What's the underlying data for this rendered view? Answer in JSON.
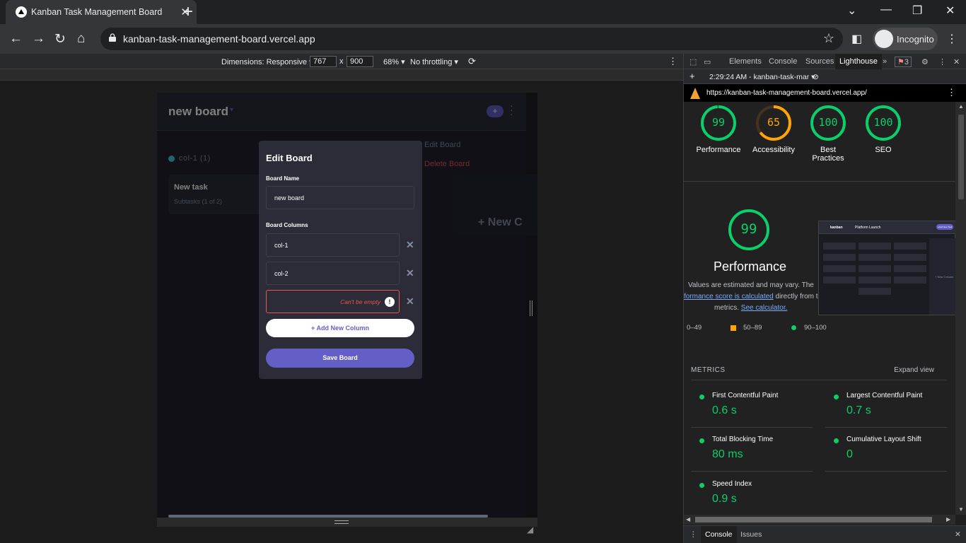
{
  "browser": {
    "tab_title": "Kanban Task Management Board",
    "url": "kanban-task-management-board.vercel.app",
    "incognito_label": "Incognito"
  },
  "device_toolbar": {
    "dimensions": "Dimensions: Responsive",
    "width": "767",
    "separator": "x",
    "height": "900",
    "zoom": "68%",
    "throttling": "No throttling"
  },
  "app": {
    "board_title": "new board",
    "add_icon": "+",
    "column_name": "col-1 (1)",
    "task_title": "New task",
    "task_subtasks": "Subtasks (1 of 2)",
    "new_column": "+ New C",
    "menu_edit": "Edit Board",
    "menu_delete": "Delete Board"
  },
  "modal": {
    "title": "Edit Board",
    "board_name_label": "Board Name",
    "board_name_value": "new board",
    "columns_label": "Board Columns",
    "columns": [
      "col-1",
      "col-2",
      ""
    ],
    "error_text": "Can't be empty",
    "add_column": "+ Add New Column",
    "save": "Save Board"
  },
  "devtools": {
    "tabs": [
      "Elements",
      "Console",
      "Sources",
      "Lighthouse"
    ],
    "more": "»",
    "issues_badge": "3",
    "report_time": "2:29:24 AM - kanban-task-mar",
    "report_url": "https://kanban-task-management-board.vercel.app/",
    "scores": [
      {
        "value": "99",
        "label": "Performance",
        "color": "#0cce6b"
      },
      {
        "value": "65",
        "label": "Accessibility",
        "color": "#ffa400"
      },
      {
        "value": "100",
        "label": "Best Practices",
        "color": "#0cce6b"
      },
      {
        "value": "100",
        "label": "SEO",
        "color": "#0cce6b"
      }
    ],
    "perf_score": "99",
    "perf_title": "Performance",
    "note_line1": "Values are estimated and may vary. The",
    "note_link1": "formance score is calculated",
    "note_line2_tail": "directly from thes",
    "note_line3": "metrics.",
    "note_link2": "See calculator.",
    "legend": [
      "0–49",
      "50–89",
      "90–100"
    ],
    "metrics_heading": "METRICS",
    "expand": "Expand view",
    "metrics": [
      {
        "name": "First Contentful Paint",
        "value": "0.6 s"
      },
      {
        "name": "Largest Contentful Paint",
        "value": "0.7 s"
      },
      {
        "name": "Total Blocking Time",
        "value": "80 ms"
      },
      {
        "name": "Cumulative Layout Shift",
        "value": "0"
      },
      {
        "name": "Speed Index",
        "value": "0.9 s"
      }
    ],
    "drawer_tabs": [
      "Console",
      "Issues"
    ],
    "thumbnail": {
      "brand": "kanban",
      "board": "Platform Launch",
      "add": "+Add New Task",
      "new_col": "+ New Column"
    }
  }
}
